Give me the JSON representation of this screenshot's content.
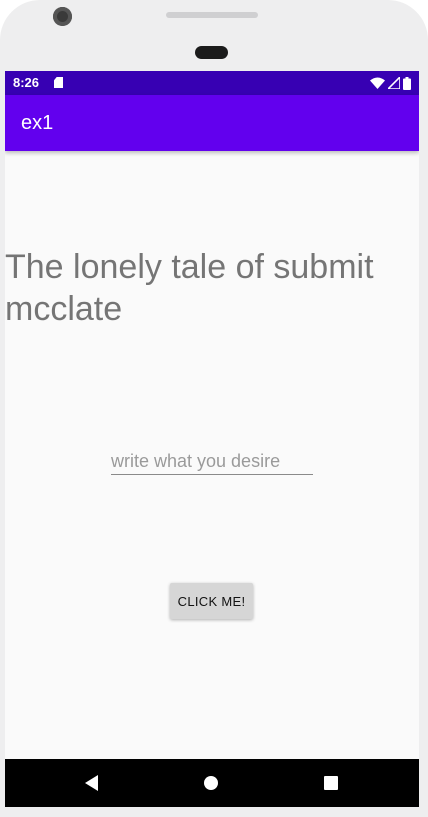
{
  "status_bar": {
    "time": "8:26",
    "icons": [
      "sd-card-icon",
      "wifi-icon",
      "signal-icon",
      "battery-icon"
    ]
  },
  "app_bar": {
    "title": "ex1"
  },
  "main": {
    "headline": "The lonely tale of submit mcclate",
    "input": {
      "value": "",
      "placeholder": "write what you desire"
    },
    "button_label": "CLICK ME!"
  },
  "nav_bar": {
    "icons": [
      "back-icon",
      "home-icon",
      "recents-icon"
    ]
  },
  "colors": {
    "status_bar": "#3700b3",
    "app_bar": "#6200ee",
    "background": "#fafafa",
    "headline_text": "#757575",
    "button": "#d6d6d6",
    "nav_bar": "#000000"
  }
}
